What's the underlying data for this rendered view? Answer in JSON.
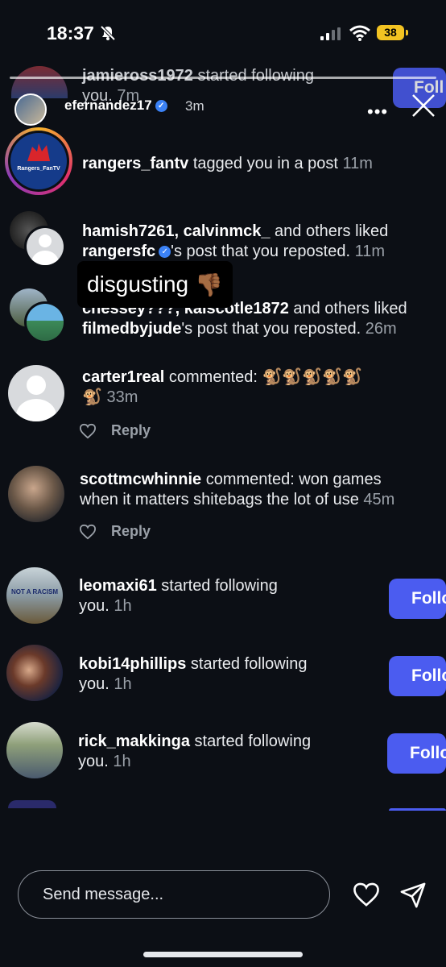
{
  "status_bar": {
    "time": "18:37",
    "battery": "38"
  },
  "story": {
    "username": "efernandez17",
    "time": "3m"
  },
  "notifications": [
    {
      "user": "jamieross1972",
      "text": " started following",
      "line2": "you.",
      "time": "7m",
      "button": "Foll"
    },
    {
      "user": "rangers_fantv",
      "text": " tagged you in a post",
      "time": "11m",
      "avatar_label": "Rangers_FanTV"
    },
    {
      "users": "hamish7261, calvinmck_",
      "text": " and others liked",
      "owner": "rangersfc",
      "line2": "'s post that you reposted.",
      "time": "11m"
    },
    {
      "users": "chessey???, kaiscotle1872",
      "text": " and others liked",
      "owner": "filmedbyjude",
      "line2": "'s post that you reposted.",
      "time": "26m"
    },
    {
      "user": "carter1real",
      "text": " commented: ",
      "emojis": "🐒🐒🐒🐒🐒",
      "line2_emoji": "🐒",
      "time": "33m",
      "reply": "Reply"
    },
    {
      "user": "scottmcwhinnie",
      "text": " commented: won games",
      "line2": "when it matters shitebags the lot of use",
      "time": "45m",
      "reply": "Reply"
    },
    {
      "user": "leomaxi61",
      "text": " started following",
      "line2": "you.",
      "time": "1h",
      "button": "Follo",
      "avatar_label": "NOT A RACISM"
    },
    {
      "user": "kobi14phillips",
      "text": " started following",
      "line2": "you.",
      "time": "1h",
      "button": "Follo"
    },
    {
      "user": "rick_makkinga",
      "text": " started following",
      "line2": "you.",
      "time": "1h",
      "button": "Follo"
    }
  ],
  "sticker": {
    "text": "disgusting",
    "emoji": "👎🏾"
  },
  "bottom": {
    "message_placeholder": "Send message..."
  },
  "colors": {
    "background": "#0c0f15",
    "follow_button": "#4b5cf0",
    "battery": "#f3c322"
  }
}
